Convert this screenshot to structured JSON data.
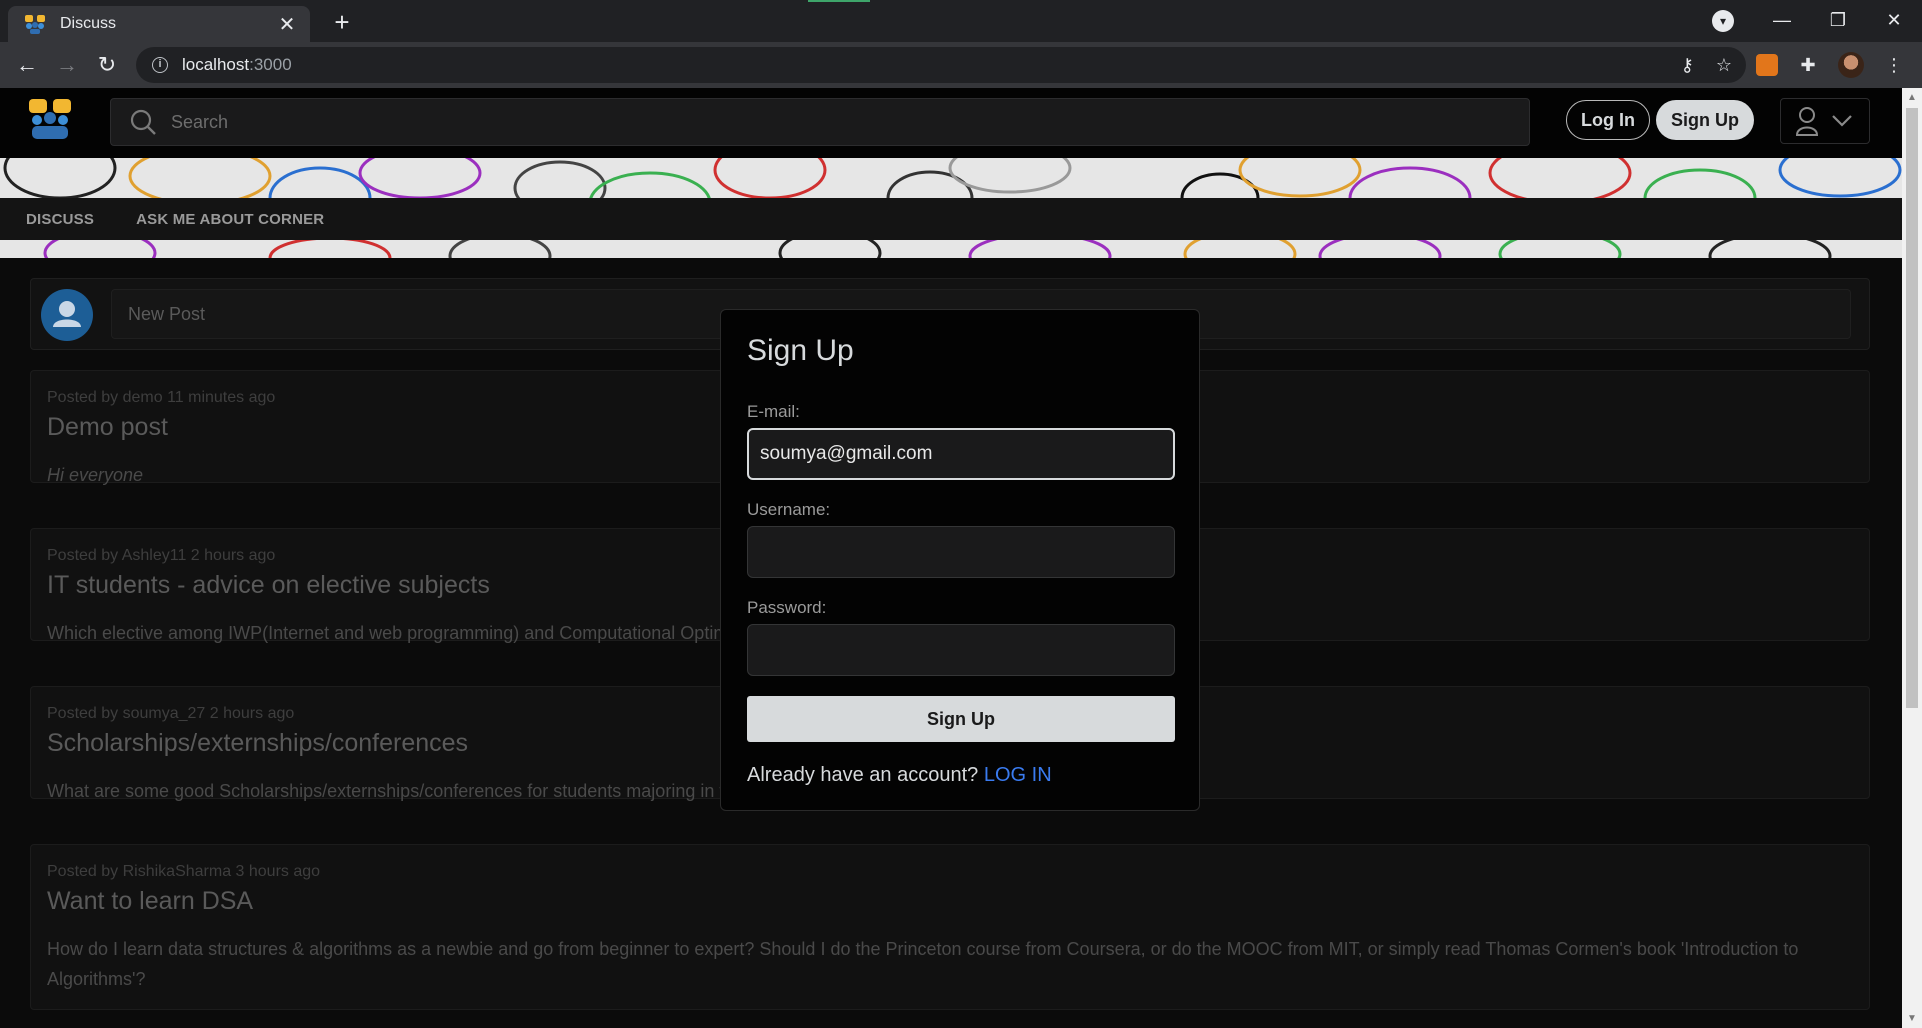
{
  "browser": {
    "tab_title": "Discuss",
    "url_host": "localhost",
    "url_port": ":3000"
  },
  "header": {
    "search_placeholder": "Search",
    "login_label": "Log In",
    "signup_label": "Sign Up"
  },
  "subnav": [
    "DISCUSS",
    "ASK ME ABOUT CORNER"
  ],
  "new_post": {
    "placeholder": "New Post"
  },
  "posts": [
    {
      "meta": "Posted by demo 11 minutes ago",
      "title": "Demo post",
      "body": "Hi everyone"
    },
    {
      "meta": "Posted by Ashley11 2 hours ago",
      "title": "IT students - advice on elective subjects",
      "body": "Which elective among IWP(Internet and web programming) and Computational Optimiz"
    },
    {
      "meta": "Posted by soumya_27 2 hours ago",
      "title": "Scholarships/externships/conferences",
      "body": "What are some good Scholarships/externships/conferences for students majoring in tec"
    },
    {
      "meta": "Posted by RishikaSharma 3 hours ago",
      "title": "Want to learn DSA",
      "body": "How do I learn data structures & algorithms as a newbie and go from beginner to expert? Should I do the Princeton course from Coursera, or do the MOOC from MIT, or simply read Thomas Cormen's book 'Introduction to Algorithms'?"
    }
  ],
  "modal": {
    "title": "Sign Up",
    "email_label": "E-mail:",
    "email_value": "soumya@gmail.com",
    "username_label": "Username:",
    "username_value": "",
    "password_label": "Password:",
    "password_value": "",
    "submit_label": "Sign Up",
    "footer_text": "Already have an account?",
    "footer_link": "LOG IN"
  },
  "colors": {
    "accent_link": "#3a7bf0",
    "page_bg": "#0b0b0b",
    "chrome_bg": "#202124"
  }
}
